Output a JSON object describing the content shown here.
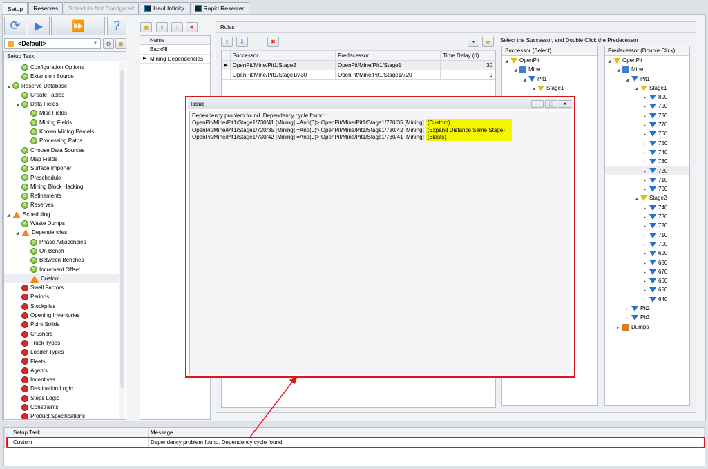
{
  "tabs": [
    {
      "label": "Setup",
      "state": "active"
    },
    {
      "label": "Reserves",
      "state": "normal"
    },
    {
      "label": "Schedule Not Configured",
      "state": "disabled"
    },
    {
      "label": "Haul Infinity",
      "state": "normal",
      "icon": "haul-infinity-icon"
    },
    {
      "label": "Rapid Reserver",
      "state": "normal",
      "icon": "rapid-reserver-icon"
    }
  ],
  "profile": {
    "selected": "<Default>"
  },
  "setup_task": {
    "header": "Setup Task",
    "items": [
      {
        "label": "Configuration Options",
        "level": 1,
        "status": "ok"
      },
      {
        "label": "Extension Source",
        "level": 1,
        "status": "ok"
      },
      {
        "label": "Reserve Database",
        "level": 0,
        "status": "ok",
        "expanded": true
      },
      {
        "label": "Create Tables",
        "level": 1,
        "status": "ok"
      },
      {
        "label": "Data Fields",
        "level": 1,
        "status": "ok",
        "expanded": true
      },
      {
        "label": "Misc Fields",
        "level": 2,
        "status": "ok"
      },
      {
        "label": "Mining Fields",
        "level": 2,
        "status": "ok"
      },
      {
        "label": "Known Mining Parcels",
        "level": 2,
        "status": "ok"
      },
      {
        "label": "Processing Paths",
        "level": 2,
        "status": "ok"
      },
      {
        "label": "Choose Data Sources",
        "level": 1,
        "status": "ok"
      },
      {
        "label": "Map Fields",
        "level": 1,
        "status": "ok"
      },
      {
        "label": "Surface Importer",
        "level": 1,
        "status": "ok"
      },
      {
        "label": "Preschedule",
        "level": 1,
        "status": "ok"
      },
      {
        "label": "Mining Block Hacking",
        "level": 1,
        "status": "ok"
      },
      {
        "label": "Refinements",
        "level": 1,
        "status": "ok"
      },
      {
        "label": "Reserves",
        "level": 1,
        "status": "ok"
      },
      {
        "label": "Scheduling",
        "level": 0,
        "status": "warn",
        "expanded": true
      },
      {
        "label": "Waste Dumps",
        "level": 1,
        "status": "ok"
      },
      {
        "label": "Dependencies",
        "level": 1,
        "status": "warn",
        "expanded": true
      },
      {
        "label": "Phase Adjacencies",
        "level": 2,
        "status": "ok"
      },
      {
        "label": "On Bench",
        "level": 2,
        "status": "ok"
      },
      {
        "label": "Between Benches",
        "level": 2,
        "status": "ok"
      },
      {
        "label": "Increment Offset",
        "level": 2,
        "status": "ok"
      },
      {
        "label": "Custom",
        "level": 2,
        "status": "warn",
        "selected": true
      },
      {
        "label": "Swell Factors",
        "level": 1,
        "status": "err"
      },
      {
        "label": "Periods",
        "level": 1,
        "status": "err"
      },
      {
        "label": "Stockpiles",
        "level": 1,
        "status": "err"
      },
      {
        "label": "Opening Inventories",
        "level": 1,
        "status": "err"
      },
      {
        "label": "Point Solids",
        "level": 1,
        "status": "err"
      },
      {
        "label": "Crushers",
        "level": 1,
        "status": "err"
      },
      {
        "label": "Truck Types",
        "level": 1,
        "status": "err"
      },
      {
        "label": "Loader Types",
        "level": 1,
        "status": "err"
      },
      {
        "label": "Fleets",
        "level": 1,
        "status": "err"
      },
      {
        "label": "Agents",
        "level": 1,
        "status": "err"
      },
      {
        "label": "Incentives",
        "level": 1,
        "status": "err"
      },
      {
        "label": "Destination Logic",
        "level": 1,
        "status": "err"
      },
      {
        "label": "Steps Logic",
        "level": 1,
        "status": "err"
      },
      {
        "label": "Constraints",
        "level": 1,
        "status": "err"
      },
      {
        "label": "Product Specifications",
        "level": 1,
        "status": "err"
      }
    ]
  },
  "name_list": {
    "header": "Name",
    "rows": [
      "Backfill",
      "Mining Dependencies"
    ],
    "selected_index": 1
  },
  "rules": {
    "title": "Rules",
    "columns": [
      "Successor",
      "Predecessor",
      "Time Delay (d)"
    ],
    "rows": [
      [
        "OpenPit/Mine/Pit1/Stage2",
        "OpenPit/Mine/Pit1/Stage1",
        "30"
      ],
      [
        "OpenPit/Mine/Pit1/Stage1/730",
        "OpenPit/Mine/Pit1/Stage1/720",
        "0"
      ]
    ]
  },
  "instruction": "Select the Successor, and Double Click the Predecessor",
  "successor_tree": {
    "header": "Successor (Select)",
    "nodes": [
      {
        "label": "OpenPit",
        "level": 0,
        "type": "pit"
      },
      {
        "label": "Mine",
        "level": 1,
        "type": "mine"
      },
      {
        "label": "Pit1",
        "level": 2,
        "type": "blue"
      },
      {
        "label": "Stage1",
        "level": 3,
        "type": "yellow"
      }
    ]
  },
  "predecessor_tree": {
    "header": "Predecessor (Double Click)",
    "nodes": [
      {
        "label": "OpenPit",
        "level": 0,
        "type": "pit"
      },
      {
        "label": "Mine",
        "level": 1,
        "type": "mine"
      },
      {
        "label": "Pit1",
        "level": 2,
        "type": "blue"
      },
      {
        "label": "Stage1",
        "level": 3,
        "type": "yellow"
      },
      {
        "label": "800",
        "level": 4,
        "type": "blue"
      },
      {
        "label": "790",
        "level": 4,
        "type": "blue"
      },
      {
        "label": "780",
        "level": 4,
        "type": "blue"
      },
      {
        "label": "770",
        "level": 4,
        "type": "blue"
      },
      {
        "label": "760",
        "level": 4,
        "type": "blue"
      },
      {
        "label": "750",
        "level": 4,
        "type": "blue"
      },
      {
        "label": "740",
        "level": 4,
        "type": "blue"
      },
      {
        "label": "730",
        "level": 4,
        "type": "blue"
      },
      {
        "label": "720",
        "level": 4,
        "type": "blue",
        "selected": true
      },
      {
        "label": "710",
        "level": 4,
        "type": "blue"
      },
      {
        "label": "700",
        "level": 4,
        "type": "blue"
      },
      {
        "label": "Stage2",
        "level": 3,
        "type": "yellow"
      },
      {
        "label": "740",
        "level": 4,
        "type": "blue"
      },
      {
        "label": "730",
        "level": 4,
        "type": "blue"
      },
      {
        "label": "720",
        "level": 4,
        "type": "blue"
      },
      {
        "label": "710",
        "level": 4,
        "type": "blue"
      },
      {
        "label": "700",
        "level": 4,
        "type": "blue"
      },
      {
        "label": "690",
        "level": 4,
        "type": "blue"
      },
      {
        "label": "680",
        "level": 4,
        "type": "blue"
      },
      {
        "label": "670",
        "level": 4,
        "type": "blue"
      },
      {
        "label": "660",
        "level": 4,
        "type": "blue"
      },
      {
        "label": "650",
        "level": 4,
        "type": "blue"
      },
      {
        "label": "640",
        "level": 4,
        "type": "blue"
      },
      {
        "label": "Pit2",
        "level": 2,
        "type": "blue",
        "collapsed": true
      },
      {
        "label": "Pit3",
        "level": 2,
        "type": "blue",
        "collapsed": true
      },
      {
        "label": "Dumps",
        "level": 1,
        "type": "dump",
        "collapsed": true
      }
    ]
  },
  "issue_dialog": {
    "title": "Issue",
    "lines": [
      {
        "text": "Dependency problem found. Dependency cycle found:",
        "tag": ""
      },
      {
        "text": "OpenPit/Mine/Pit1/Stage1/730/41 [Mining]  =And(0)> OpenPit/Mine/Pit1/Stage1/720/35 [Mining]",
        "tag": "(Custom)"
      },
      {
        "text": "OpenPit/Mine/Pit1/Stage1/720/35 [Mining]  =And(0)> OpenPit/Mine/Pit1/Stage1/730/42 [Mining]",
        "tag": "(Expand Distance Same Stage)"
      },
      {
        "text": "OpenPit/Mine/Pit1/Stage1/730/42 [Mining]  =And(0)> OpenPit/Mine/Pit1/Stage1/730/41 [Mining]",
        "tag": "(Blasts)"
      }
    ]
  },
  "messages": {
    "columns": [
      "Setup Task",
      "Message"
    ],
    "rows": [
      [
        "Custom",
        "Dependency problem found. Dependency cycle found:"
      ]
    ]
  },
  "colors": {
    "highlight": "#f5f500",
    "annotation": "#e0141b"
  }
}
